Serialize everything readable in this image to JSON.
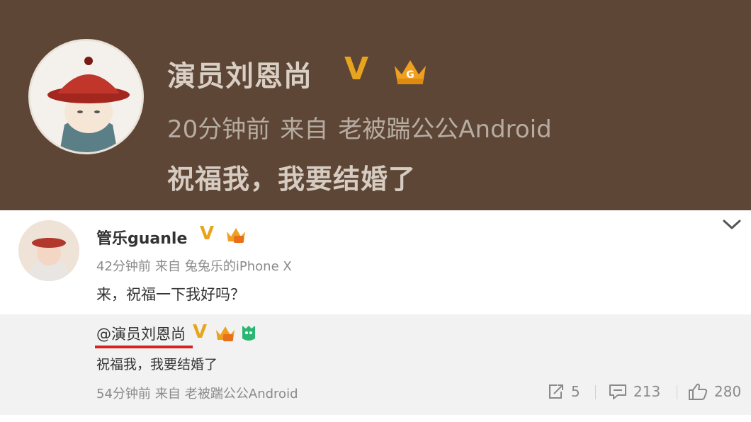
{
  "banner": {
    "name": "演员刘恩尚",
    "verified": "V",
    "time": "20分钟前",
    "from": "来自",
    "source": "老被踹公公Android",
    "text": "祝福我，我要结婚了"
  },
  "post": {
    "name": "管乐guanle",
    "verified": "V",
    "time": "42分钟前",
    "from": "来自",
    "source": "兔兔乐的iPhone X",
    "text": "来，祝福一下我好吗？"
  },
  "repost": {
    "user": "@演员刘恩尚",
    "verified": "V",
    "text": "祝福我，我要结婚了",
    "time": "54分钟前",
    "from": "来自",
    "source": "老被踹公公Android",
    "share_count": "5",
    "comment_count": "213",
    "like_count": "280"
  },
  "colors": {
    "banner_bg": "#5d4636",
    "verified_gold": "#e7a51d",
    "mention_underline": "#d62222"
  },
  "icons": [
    "crown-icon",
    "chevron-down-icon",
    "share-icon",
    "comment-icon",
    "like-icon",
    "member-badge-icon"
  ]
}
